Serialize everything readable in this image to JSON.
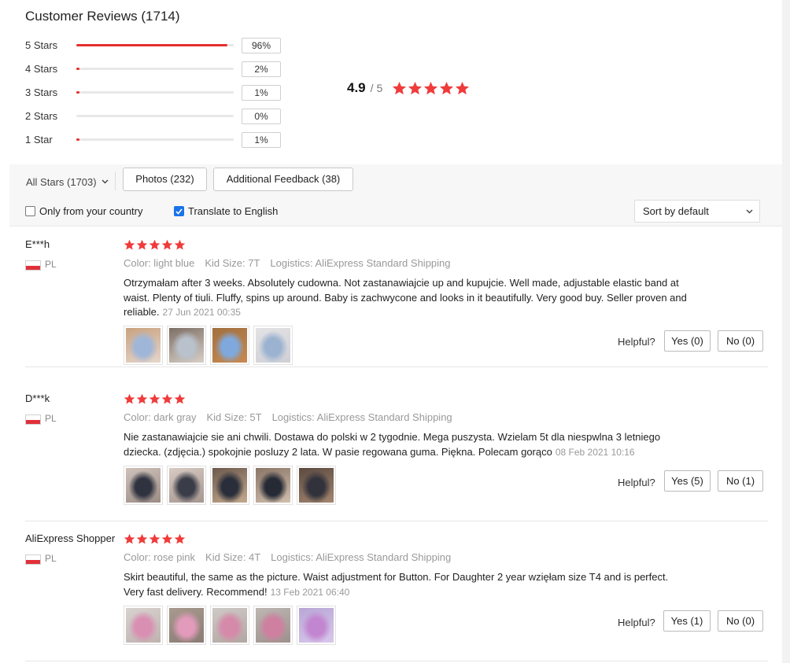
{
  "title": "Customer Reviews (1714)",
  "distribution": [
    {
      "label": "5 Stars",
      "percent": "96%",
      "fraction": 0.96
    },
    {
      "label": "4 Stars",
      "percent": "2%",
      "fraction": 0.02
    },
    {
      "label": "3 Stars",
      "percent": "1%",
      "fraction": 0.01
    },
    {
      "label": "2 Stars",
      "percent": "0%",
      "fraction": 0.0
    },
    {
      "label": "1 Star",
      "percent": "1%",
      "fraction": 0.01
    }
  ],
  "score": {
    "value": "4.9",
    "separator": "/",
    "max": "5",
    "stars": 5
  },
  "filters": {
    "all_stars": "All Stars (1703)",
    "photos": "Photos (232)",
    "additional": "Additional Feedback (38)",
    "only_country": "Only from your country",
    "only_country_checked": false,
    "translate": "Translate to English",
    "translate_checked": true,
    "sort": "Sort by default"
  },
  "reviews": [
    {
      "user": "E***h",
      "country": "PL",
      "stars": 5,
      "color": "Color: light blue",
      "size": "Kid Size: 7T",
      "logistics": "Logistics: AliExpress Standard Shipping",
      "text": "Otrzymałam after 3 weeks. Absolutely cudowna. Not zastanawiajcie up and kupujcie. Well made, adjustable elastic band at waist. Plenty of tiuli. Fluffy, spins up around. Baby is zachwycone and looks in it beautifully. Very good buy. Seller proven and reliable.",
      "date": "27 Jun 2021 00:35",
      "helpful": "Helpful?",
      "yes": "Yes (0)",
      "no": "No (0)",
      "photos": [
        {
          "name": "photo-light-blue-skirt-1",
          "colors": [
            "#c9a27f",
            "#9fb6d9",
            "#e5d6cc"
          ]
        },
        {
          "name": "photo-light-blue-skirt-2",
          "colors": [
            "#7d6f66",
            "#b9c2cc",
            "#d8cfc6"
          ]
        },
        {
          "name": "photo-light-blue-skirt-3",
          "colors": [
            "#a2703f",
            "#7fa9dd",
            "#c58a52"
          ]
        },
        {
          "name": "photo-light-blue-skirt-4",
          "colors": [
            "#e3e2e4",
            "#9bb3d0",
            "#cfcfd6"
          ]
        }
      ]
    },
    {
      "user": "D***k",
      "country": "PL",
      "stars": 5,
      "color": "Color: dark gray",
      "size": "Kid Size: 5T",
      "logistics": "Logistics: AliExpress Standard Shipping",
      "text": "Nie zastanawiajcie sie ani chwili. Dostawa do polski w 2 tygodnie. Mega puszysta. Wzielam 5t dla niespwlna 3 letniego dziecka. (zdjęcia.) spokojnie posluzy 2 lata. W pasie regowana guma. Piękna. Polecam gorąco",
      "date": "08 Feb 2021 10:16",
      "helpful": "Helpful?",
      "yes": "Yes (5)",
      "no": "No (1)",
      "photos": [
        {
          "name": "photo-dark-gray-skirt-1",
          "colors": [
            "#cfc2bb",
            "#2f3340",
            "#9c8d86"
          ]
        },
        {
          "name": "photo-dark-gray-skirt-2",
          "colors": [
            "#d8cbc3",
            "#3a3d48",
            "#a59690"
          ]
        },
        {
          "name": "photo-dark-gray-skirt-3",
          "colors": [
            "#6d5a4e",
            "#2a2e3a",
            "#c4a98d"
          ]
        },
        {
          "name": "photo-dark-gray-skirt-4",
          "colors": [
            "#8a7567",
            "#262a35",
            "#d1bfae"
          ]
        },
        {
          "name": "photo-dark-gray-skirt-5",
          "colors": [
            "#5a4a40",
            "#31323b",
            "#a58670"
          ]
        }
      ]
    },
    {
      "user": "AliExpress Shopper",
      "country": "PL",
      "stars": 5,
      "color": "Color: rose pink",
      "size": "Kid Size: 4T",
      "logistics": "Logistics: AliExpress Standard Shipping",
      "text": "Skirt beautiful, the same as the picture. Waist adjustment for Button. For Daughter 2 year wzięłam size T4 and is perfect. Very fast delivery. Recommend!",
      "date": "13 Feb 2021 06:40",
      "helpful": "Helpful?",
      "yes": "Yes (1)",
      "no": "No (0)",
      "photos": [
        {
          "name": "photo-rose-pink-skirt-1",
          "colors": [
            "#d8d2cf",
            "#d98fb2",
            "#bfb3b0"
          ]
        },
        {
          "name": "photo-rose-pink-skirt-2",
          "colors": [
            "#a99a8f",
            "#e29bbb",
            "#8a7c74"
          ]
        },
        {
          "name": "photo-rose-pink-skirt-3",
          "colors": [
            "#cfcac7",
            "#d58aa9",
            "#b2a6a2"
          ]
        },
        {
          "name": "photo-rose-pink-skirt-4",
          "colors": [
            "#bdb6b2",
            "#cf7fa0",
            "#9d918d"
          ]
        },
        {
          "name": "photo-rose-pink-skirt-5",
          "colors": [
            "#b8a7d6",
            "#c286d0",
            "#d9c7ea"
          ]
        }
      ]
    }
  ]
}
